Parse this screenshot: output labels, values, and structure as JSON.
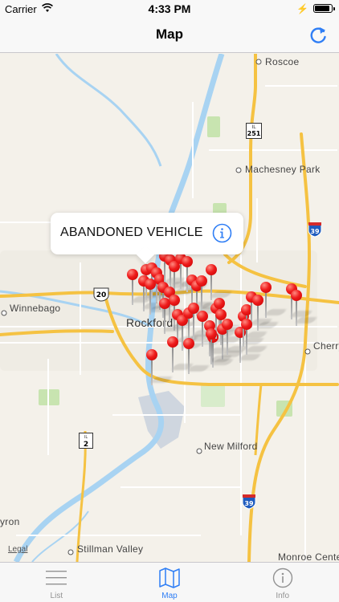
{
  "status_bar": {
    "carrier": "Carrier",
    "time": "4:33 PM",
    "battery_fraction": 0.9
  },
  "nav": {
    "title": "Map"
  },
  "map": {
    "places": {
      "roscoe": "Roscoe",
      "machesney_park": "Machesney Park",
      "winnebago": "Winnebago",
      "rockford": "Rockford",
      "cherry": "Cherry",
      "new_milford": "New Milford",
      "stillman_valley": "Stillman Valley",
      "monroe_center": "Monroe Center",
      "byron": "yron"
    },
    "shields": {
      "il251": {
        "state": "IL",
        "number": "251"
      },
      "us20": "20",
      "i39_north": "39",
      "i39_south": "39",
      "il2": {
        "state": "IL",
        "number": "2"
      }
    },
    "legal": "Legal",
    "callout": {
      "title": "ABANDONED VEHICLE"
    },
    "pin_count": 45
  },
  "tabs": [
    {
      "label": "List",
      "icon": "list-icon",
      "active": false
    },
    {
      "label": "Map",
      "icon": "map-icon",
      "active": true
    },
    {
      "label": "Info",
      "icon": "info-icon",
      "active": false
    }
  ],
  "colors": {
    "accent": "#2f7ef5",
    "pin": "#ee1c1c",
    "highway": "#f5c242",
    "water": "#a8d3f2",
    "park": "#c8e4b0"
  }
}
